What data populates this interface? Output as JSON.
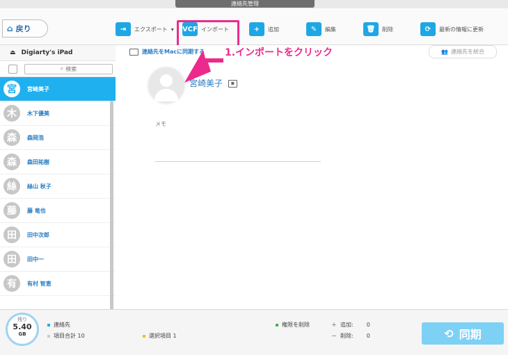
{
  "window": {
    "title": "連絡先管理"
  },
  "toolbar": {
    "back_label": "戻り",
    "export_label": "エクスポート",
    "import_label": "インポート",
    "add_label": "追加",
    "edit_label": "編集",
    "delete_label": "削除",
    "update_label": "最新の情報に更新"
  },
  "sidebar": {
    "device_name": "Digiarty's iPad",
    "search_placeholder": "検索",
    "contacts": [
      {
        "initial": "宮",
        "name": "宮崎美子",
        "selected": true
      },
      {
        "initial": "木",
        "name": "木下優美"
      },
      {
        "initial": "森",
        "name": "森岡浩"
      },
      {
        "initial": "森",
        "name": "森田祐樹"
      },
      {
        "initial": "絲",
        "name": "絲山 秋子"
      },
      {
        "initial": "藤",
        "name": "藤 竜也"
      },
      {
        "initial": "田",
        "name": "田中次郎"
      },
      {
        "initial": "田",
        "name": "田中一"
      },
      {
        "initial": "有",
        "name": "有村 智恵"
      }
    ]
  },
  "main": {
    "sync_link": "連絡先をMacに同期する",
    "merge_label": "連絡先を統合",
    "contact_name": "宮崎美子",
    "memo_label": "メモ"
  },
  "annotation": {
    "text": "1.インポートをクリック",
    "color": "#ec2a8c"
  },
  "footer": {
    "storage_prefix": "残り",
    "storage_value": "5.40",
    "storage_unit": "GB",
    "contacts_label": "連絡先",
    "total_label": "項目合計 10",
    "selected_label": "選択項目 1",
    "perm_delete_label": "権限を削除",
    "add_count_label": "追加:",
    "add_count": "0",
    "delete_count_label": "削除:",
    "delete_count": "0",
    "sync_label": "同期"
  },
  "colors": {
    "accent": "#1eb0ef",
    "highlight": "#ec2a8c",
    "sync_button": "#7cd1f5"
  }
}
